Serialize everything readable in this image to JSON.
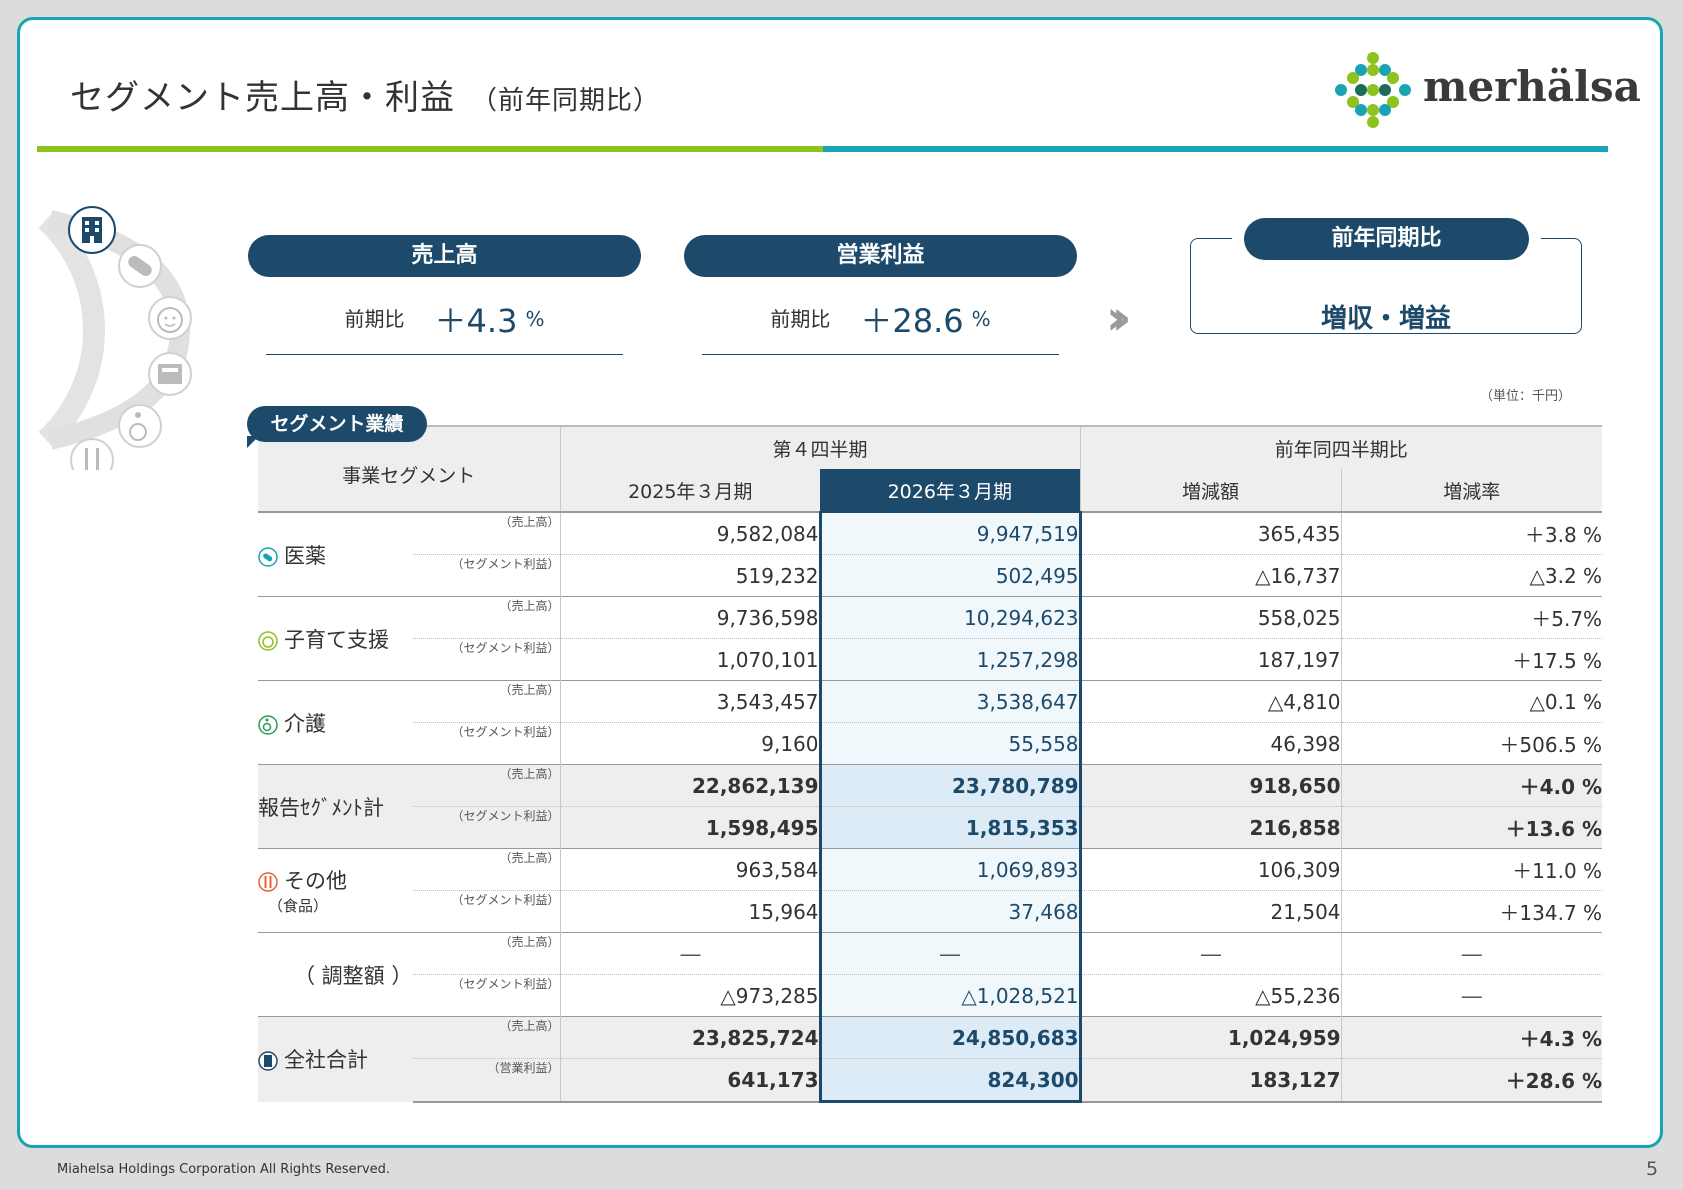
{
  "title": "セグメント売上高・利益",
  "title_sub": "（前年同期比）",
  "logo_text": "merhälsa",
  "kpis": [
    {
      "label": "売上高",
      "sub_label": "前期比",
      "value": "＋4.3",
      "unit": "%"
    },
    {
      "label": "営業利益",
      "sub_label": "前期比",
      "value": "＋28.6",
      "unit": "%"
    }
  ],
  "yoy": {
    "label": "前年同期比",
    "value": "増収・増益"
  },
  "unit_note": "（単位：千円）",
  "segment_tab": "セグメント業績",
  "header": {
    "segment": "事業セグメント",
    "quarter": "第４四半期",
    "yoy_quarter": "前年同四半期比",
    "prev": "2025年３月期",
    "cur": "2026年３月期",
    "diff": "増減額",
    "rate": "増減率"
  },
  "kinds": {
    "sales": "（売上高）",
    "seg_profit": "（セグメント利益）",
    "op_profit": "（営業利益）"
  },
  "rows": {
    "pharma": {
      "name": "医薬",
      "sales": [
        "9,582,084",
        "9,947,519",
        "365,435",
        "＋3.8 %"
      ],
      "profit": [
        "519,232",
        "502,495",
        "△16,737",
        "△3.2 %"
      ]
    },
    "child": {
      "name": "子育て支援",
      "sales": [
        "9,736,598",
        "10,294,623",
        "558,025",
        "＋5.7%"
      ],
      "profit": [
        "1,070,101",
        "1,257,298",
        "187,197",
        "＋17.5 %"
      ]
    },
    "care": {
      "name": "介護",
      "sales": [
        "3,543,457",
        "3,538,647",
        "△4,810",
        "△0.1 %"
      ],
      "profit": [
        "9,160",
        "55,558",
        "46,398",
        "＋506.5 %"
      ]
    },
    "reported": {
      "name": "報告ｾｸﾞﾒﾝﾄ計",
      "sales": [
        "22,862,139",
        "23,780,789",
        "918,650",
        "＋4.0 %"
      ],
      "profit": [
        "1,598,495",
        "1,815,353",
        "216,858",
        "＋13.6 %"
      ]
    },
    "other": {
      "name": "その他",
      "sub": "（食品）",
      "sales": [
        "963,584",
        "1,069,893",
        "106,309",
        "＋11.0 %"
      ],
      "profit": [
        "15,964",
        "37,468",
        "21,504",
        "＋134.7 %"
      ]
    },
    "adjust": {
      "name": "（ 調整額 ）",
      "sales": [
        "―",
        "―",
        "―",
        "―"
      ],
      "profit": [
        "△973,285",
        "△1,028,521",
        "△55,236",
        "―"
      ]
    },
    "total": {
      "name": "全社合計",
      "sales": [
        "23,825,724",
        "24,850,683",
        "1,024,959",
        "＋4.3 %"
      ],
      "profit": [
        "641,173",
        "824,300",
        "183,127",
        "＋28.6 %"
      ]
    }
  },
  "colors": {
    "navy": "#1d4a6b",
    "teal": "#1aa3b4",
    "green": "#8dc21f"
  },
  "side_icons": [
    "building-icon",
    "capsule-icon",
    "child-face-icon",
    "package-icon",
    "wheelchair-icon",
    "fork-spoon-icon"
  ],
  "footer": "Miahelsa Holdings Corporation All Rights Reserved.",
  "page_number": "5"
}
